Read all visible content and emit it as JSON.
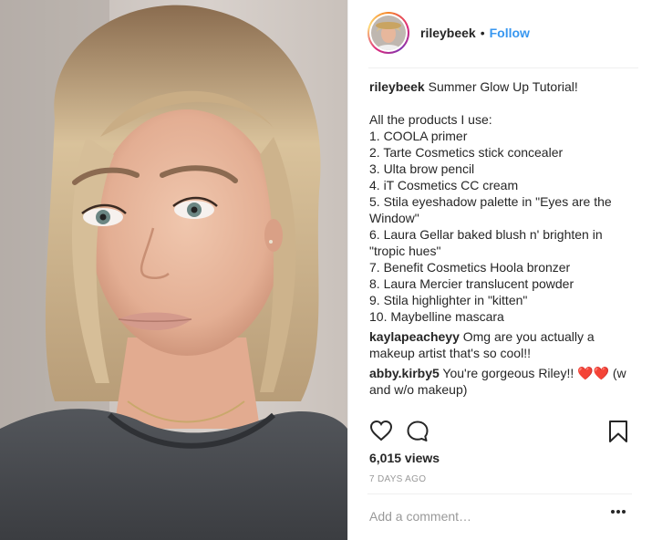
{
  "post": {
    "username": "rileybeek",
    "separator": "•",
    "follow_label": "Follow",
    "caption": {
      "username": "rileybeek",
      "title": "Summer Glow Up Tutorial!",
      "intro": "All the products I use:",
      "lines": [
        "1. COOLA primer",
        "2. Tarte Cosmetics stick concealer",
        "3. Ulta brow pencil",
        "4. iT Cosmetics CC cream",
        "5. Stila eyeshadow palette in \"Eyes are the",
        "Window\"",
        "6. Laura Gellar baked blush n' brighten in",
        "\"tropic hues\"",
        "7. Benefit Cosmetics Hoola bronzer",
        "8. Laura Mercier translucent powder",
        "9. Stila highlighter in \"kitten\"",
        "10. Maybelline mascara"
      ]
    },
    "comments": [
      {
        "username": "kaylapeacheyy",
        "text": "Omg are you actually a makeup artist that's so cool!!"
      },
      {
        "username": "abby.kirby5",
        "text": "You're gorgeous Riley!! ❤️❤️ (w and w/o makeup)"
      }
    ],
    "views": "6,015 views",
    "timestamp": "7 DAYS AGO",
    "comment_placeholder": "Add a comment…"
  },
  "icons": {
    "like": "heart-icon",
    "comment": "comment-bubble-icon",
    "save": "bookmark-icon",
    "more": "more-options-icon"
  },
  "colors": {
    "link": "#3897f0",
    "text": "#262626",
    "muted": "#999999",
    "divider": "#efefef",
    "heart": "#ed4956"
  }
}
